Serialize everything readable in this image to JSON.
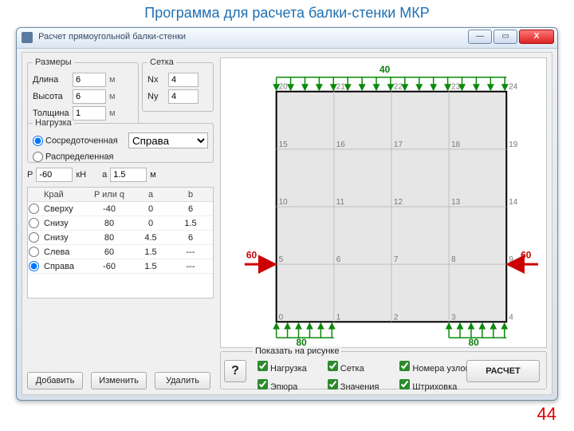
{
  "page": {
    "heading": "Программа для расчета балки-стенки МКР",
    "number": "44"
  },
  "window": {
    "title": "Расчет прямоугольной балки-стенки",
    "btn_min": "—",
    "btn_max": "▭",
    "btn_close": "X"
  },
  "dims": {
    "legend": "Размеры",
    "len_label": "Длина",
    "len_val": "6",
    "len_unit": "м",
    "h_label": "Высота",
    "h_val": "6",
    "h_unit": "м",
    "t_label": "Толщина",
    "t_val": "1",
    "t_unit": "м"
  },
  "grid": {
    "legend": "Сетка",
    "nx_label": "Nx",
    "nx_val": "4",
    "ny_label": "Ny",
    "ny_val": "4"
  },
  "load": {
    "legend": "Нагрузка",
    "conc": "Сосредоточенная",
    "dist": "Распределенная",
    "direction": "Справа",
    "p_label": "P",
    "p_val": "-60",
    "p_unit": "кН",
    "a_label": "a",
    "a_val": "1.5",
    "a_unit": "м"
  },
  "table": {
    "hdr": [
      "",
      "Край",
      "P или q",
      "a",
      "b"
    ],
    "rows": [
      {
        "sel": false,
        "side": "Сверху",
        "p": "-40",
        "a": "0",
        "b": "6"
      },
      {
        "sel": false,
        "side": "Снизу",
        "p": "80",
        "a": "0",
        "b": "1.5"
      },
      {
        "sel": false,
        "side": "Снизу",
        "p": "80",
        "a": "4.5",
        "b": "6"
      },
      {
        "sel": false,
        "side": "Слева",
        "p": "60",
        "a": "1.5",
        "b": "---"
      },
      {
        "sel": true,
        "side": "Справа",
        "p": "-60",
        "a": "1.5",
        "b": "---"
      }
    ]
  },
  "buttons": {
    "add": "Добавить",
    "edit": "Изменить",
    "del": "Удалить",
    "calc": "РАСЧЕТ",
    "help": "?"
  },
  "show": {
    "title": "Показать на рисунке",
    "items": [
      "Нагрузка",
      "Сетка",
      "Номера узлов",
      "Эпюра",
      "Значения",
      "Штриховка"
    ]
  },
  "diagram": {
    "top_val": "40",
    "bot_val": "80",
    "side_val": "60",
    "nodes_row0": [
      "0",
      "1",
      "2",
      "3",
      "4"
    ],
    "nodes_row1": [
      "5",
      "6",
      "7",
      "8",
      "9"
    ],
    "nodes_row2": [
      "10",
      "11",
      "12",
      "13",
      "14"
    ],
    "nodes_row3": [
      "15",
      "16",
      "17",
      "18",
      "19"
    ],
    "nodes_row4": [
      "20",
      "21",
      "22",
      "23",
      "24"
    ]
  }
}
